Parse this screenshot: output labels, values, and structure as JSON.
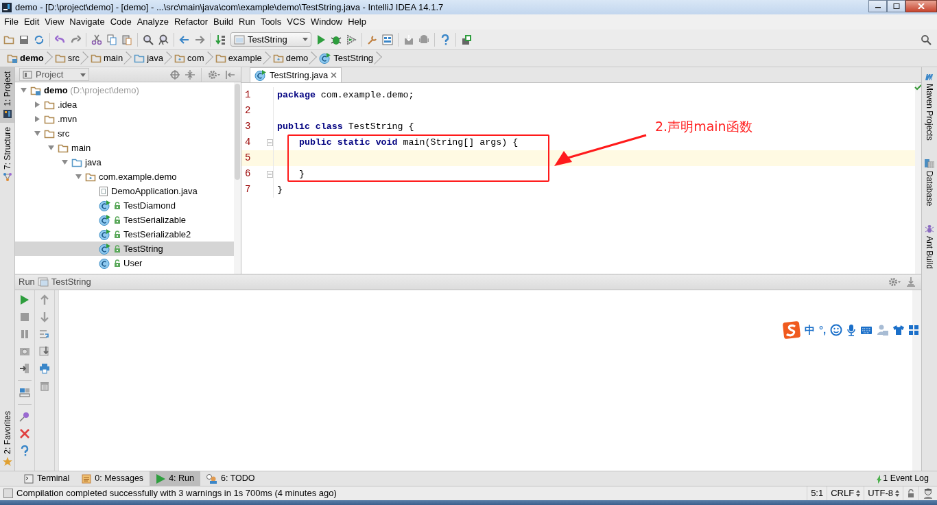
{
  "window": {
    "title": "demo - [D:\\project\\demo] - [demo] - ...\\src\\main\\java\\com\\example\\demo\\TestString.java - IntelliJ IDEA 14.1.7"
  },
  "menu": [
    "File",
    "Edit",
    "View",
    "Navigate",
    "Code",
    "Analyze",
    "Refactor",
    "Build",
    "Run",
    "Tools",
    "VCS",
    "Window",
    "Help"
  ],
  "toolbar": {
    "run_configuration": "TestString"
  },
  "breadcrumbs": [
    {
      "label": "demo",
      "kind": "module"
    },
    {
      "label": "src",
      "kind": "folder"
    },
    {
      "label": "main",
      "kind": "folder"
    },
    {
      "label": "java",
      "kind": "source"
    },
    {
      "label": "com",
      "kind": "package"
    },
    {
      "label": "example",
      "kind": "folder"
    },
    {
      "label": "demo",
      "kind": "package"
    },
    {
      "label": "TestString",
      "kind": "class"
    }
  ],
  "left_stripe": [
    {
      "label": "1: Project",
      "selected": true,
      "kind": "project"
    },
    {
      "label": "7: Structure",
      "selected": false,
      "kind": "structure"
    }
  ],
  "left_stripe_bottom": [
    {
      "label": "2: Favorites",
      "selected": false,
      "kind": "favorites"
    }
  ],
  "project_panel": {
    "title": "Project",
    "tree": [
      {
        "label": "demo",
        "hint": "(D:\\project\\demo)",
        "kind": "module",
        "expanded": true,
        "selected": false,
        "children": [
          {
            "label": ".idea",
            "kind": "folder",
            "expanded": false,
            "selected": false
          },
          {
            "label": ".mvn",
            "kind": "folder",
            "expanded": false,
            "selected": false
          },
          {
            "label": "src",
            "kind": "folder",
            "expanded": true,
            "selected": false,
            "children": [
              {
                "label": "main",
                "kind": "folder",
                "expanded": true,
                "selected": false,
                "children": [
                  {
                    "label": "java",
                    "kind": "source",
                    "expanded": true,
                    "selected": false,
                    "children": [
                      {
                        "label": "com.example.demo",
                        "kind": "package",
                        "expanded": true,
                        "selected": false,
                        "children": [
                          {
                            "label": "DemoApplication.java",
                            "kind": "file",
                            "selected": false
                          },
                          {
                            "label": "TestDiamond",
                            "kind": "runnable",
                            "selected": false
                          },
                          {
                            "label": "TestSerializable",
                            "kind": "runnable",
                            "selected": false
                          },
                          {
                            "label": "TestSerializable2",
                            "kind": "runnable",
                            "selected": false
                          },
                          {
                            "label": "TestString",
                            "kind": "runnable",
                            "selected": true
                          },
                          {
                            "label": "User",
                            "kind": "class",
                            "selected": false
                          }
                        ]
                      }
                    ]
                  }
                ]
              }
            ]
          }
        ]
      }
    ]
  },
  "editor": {
    "tabs": [
      {
        "label": "TestString.java",
        "selected": true
      }
    ],
    "lines": [
      {
        "number": "1",
        "code": "**package** com.example.demo;",
        "current": false,
        "fold": false
      },
      {
        "number": "2",
        "current": false,
        "fold": false
      },
      {
        "number": "3",
        "code": "**public class** TestString {",
        "current": false,
        "fold": false
      },
      {
        "number": "4",
        "code": "    **public static void** main(String[] args) {",
        "current": false,
        "fold": true
      },
      {
        "number": "5",
        "current": true,
        "fold": false
      },
      {
        "number": "6",
        "code": "    }",
        "current": false,
        "fold": true
      },
      {
        "number": "7",
        "code": "}",
        "current": false,
        "fold": false
      }
    ]
  },
  "annotation": {
    "text": "2.声明main函数"
  },
  "right_stripe": [
    {
      "label": "Maven Projects",
      "kind": "maven"
    },
    {
      "label": "Database",
      "kind": "database"
    },
    {
      "label": "Ant Build",
      "kind": "ant"
    }
  ],
  "run_panel": {
    "title": "Run",
    "configuration": "TestString"
  },
  "ime_toolbar": {
    "mode": "中",
    "punctuation": "°,"
  },
  "bottom_tabs": [
    {
      "label": "Terminal",
      "selected": false,
      "kind": "terminal"
    },
    {
      "label": "0: Messages",
      "selected": false,
      "kind": "messages"
    },
    {
      "label": "4: Run",
      "selected": true,
      "kind": "run"
    },
    {
      "label": "6: TODO",
      "selected": false,
      "kind": "todo"
    }
  ],
  "event_log": {
    "label": "1 Event Log"
  },
  "status_bar": {
    "message": "Compilation completed successfully with 3 warnings in 1s 700ms (4 minutes ago)",
    "position": "5:1",
    "line_separator": "CRLF",
    "encoding": "UTF-8"
  }
}
